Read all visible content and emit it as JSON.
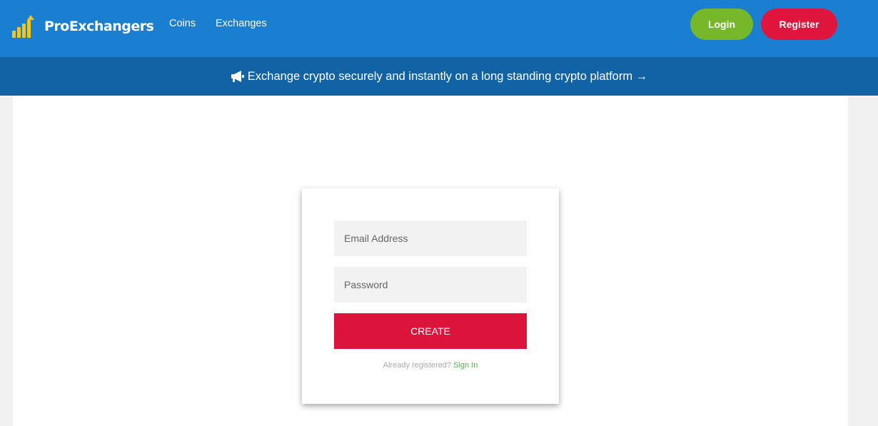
{
  "brand": {
    "name": "ProExchangers",
    "icon": "bar-chart-arrow-icon",
    "color": "#f5c518"
  },
  "nav": {
    "coins": "Coins",
    "exchanges": "Exchanges"
  },
  "auth_buttons": {
    "login": "Login",
    "register": "Register",
    "login_color": "#76b82a",
    "register_color": "#e0153e"
  },
  "announcement": {
    "icon": "megaphone-icon",
    "text": "Exchange crypto securely and instantly on a long standing crypto platform →"
  },
  "form": {
    "email_placeholder": "Email Address",
    "password_placeholder": "Password",
    "submit_label": "CREATE",
    "already_registered": "Already registered?",
    "sign_in_link": "Sign In"
  },
  "colors": {
    "header": "#1a7fd1",
    "announcement_bar": "#1262a6",
    "create_button": "#dc143c"
  }
}
